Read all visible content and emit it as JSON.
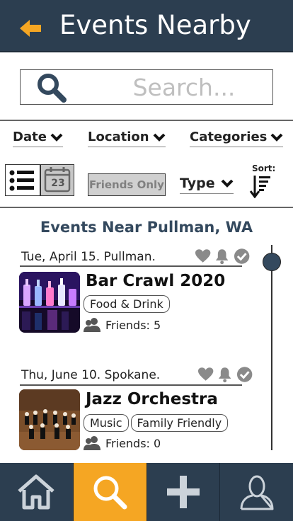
{
  "header": {
    "title": "Events Nearby",
    "back_icon": "back-arrow-icon",
    "accent": "#f5a623",
    "bg": "#2c3e50"
  },
  "search": {
    "placeholder": "Search..."
  },
  "filters": {
    "date": "Date",
    "location": "Location",
    "categories": "Categories",
    "friends_only": "Friends Only",
    "type": "Type",
    "sort_label": "Sort:",
    "calendar_day": "23"
  },
  "section_title": "Events Near Pullman, WA",
  "events": [
    {
      "date": "Tue, April 15. Pullman.",
      "title": "Bar Crawl 2020",
      "tags": [
        "Food & Drink"
      ],
      "friends": "Friends: 5"
    },
    {
      "date": "Thu, June 10. Spokane.",
      "title": "Jazz Orchestra",
      "tags": [
        "Music",
        "Family Friendly"
      ],
      "friends": "Friends: 0"
    }
  ],
  "tabbar": {
    "items": [
      "home-icon",
      "search-icon",
      "add-icon",
      "profile-icon"
    ],
    "active": "search-icon"
  }
}
